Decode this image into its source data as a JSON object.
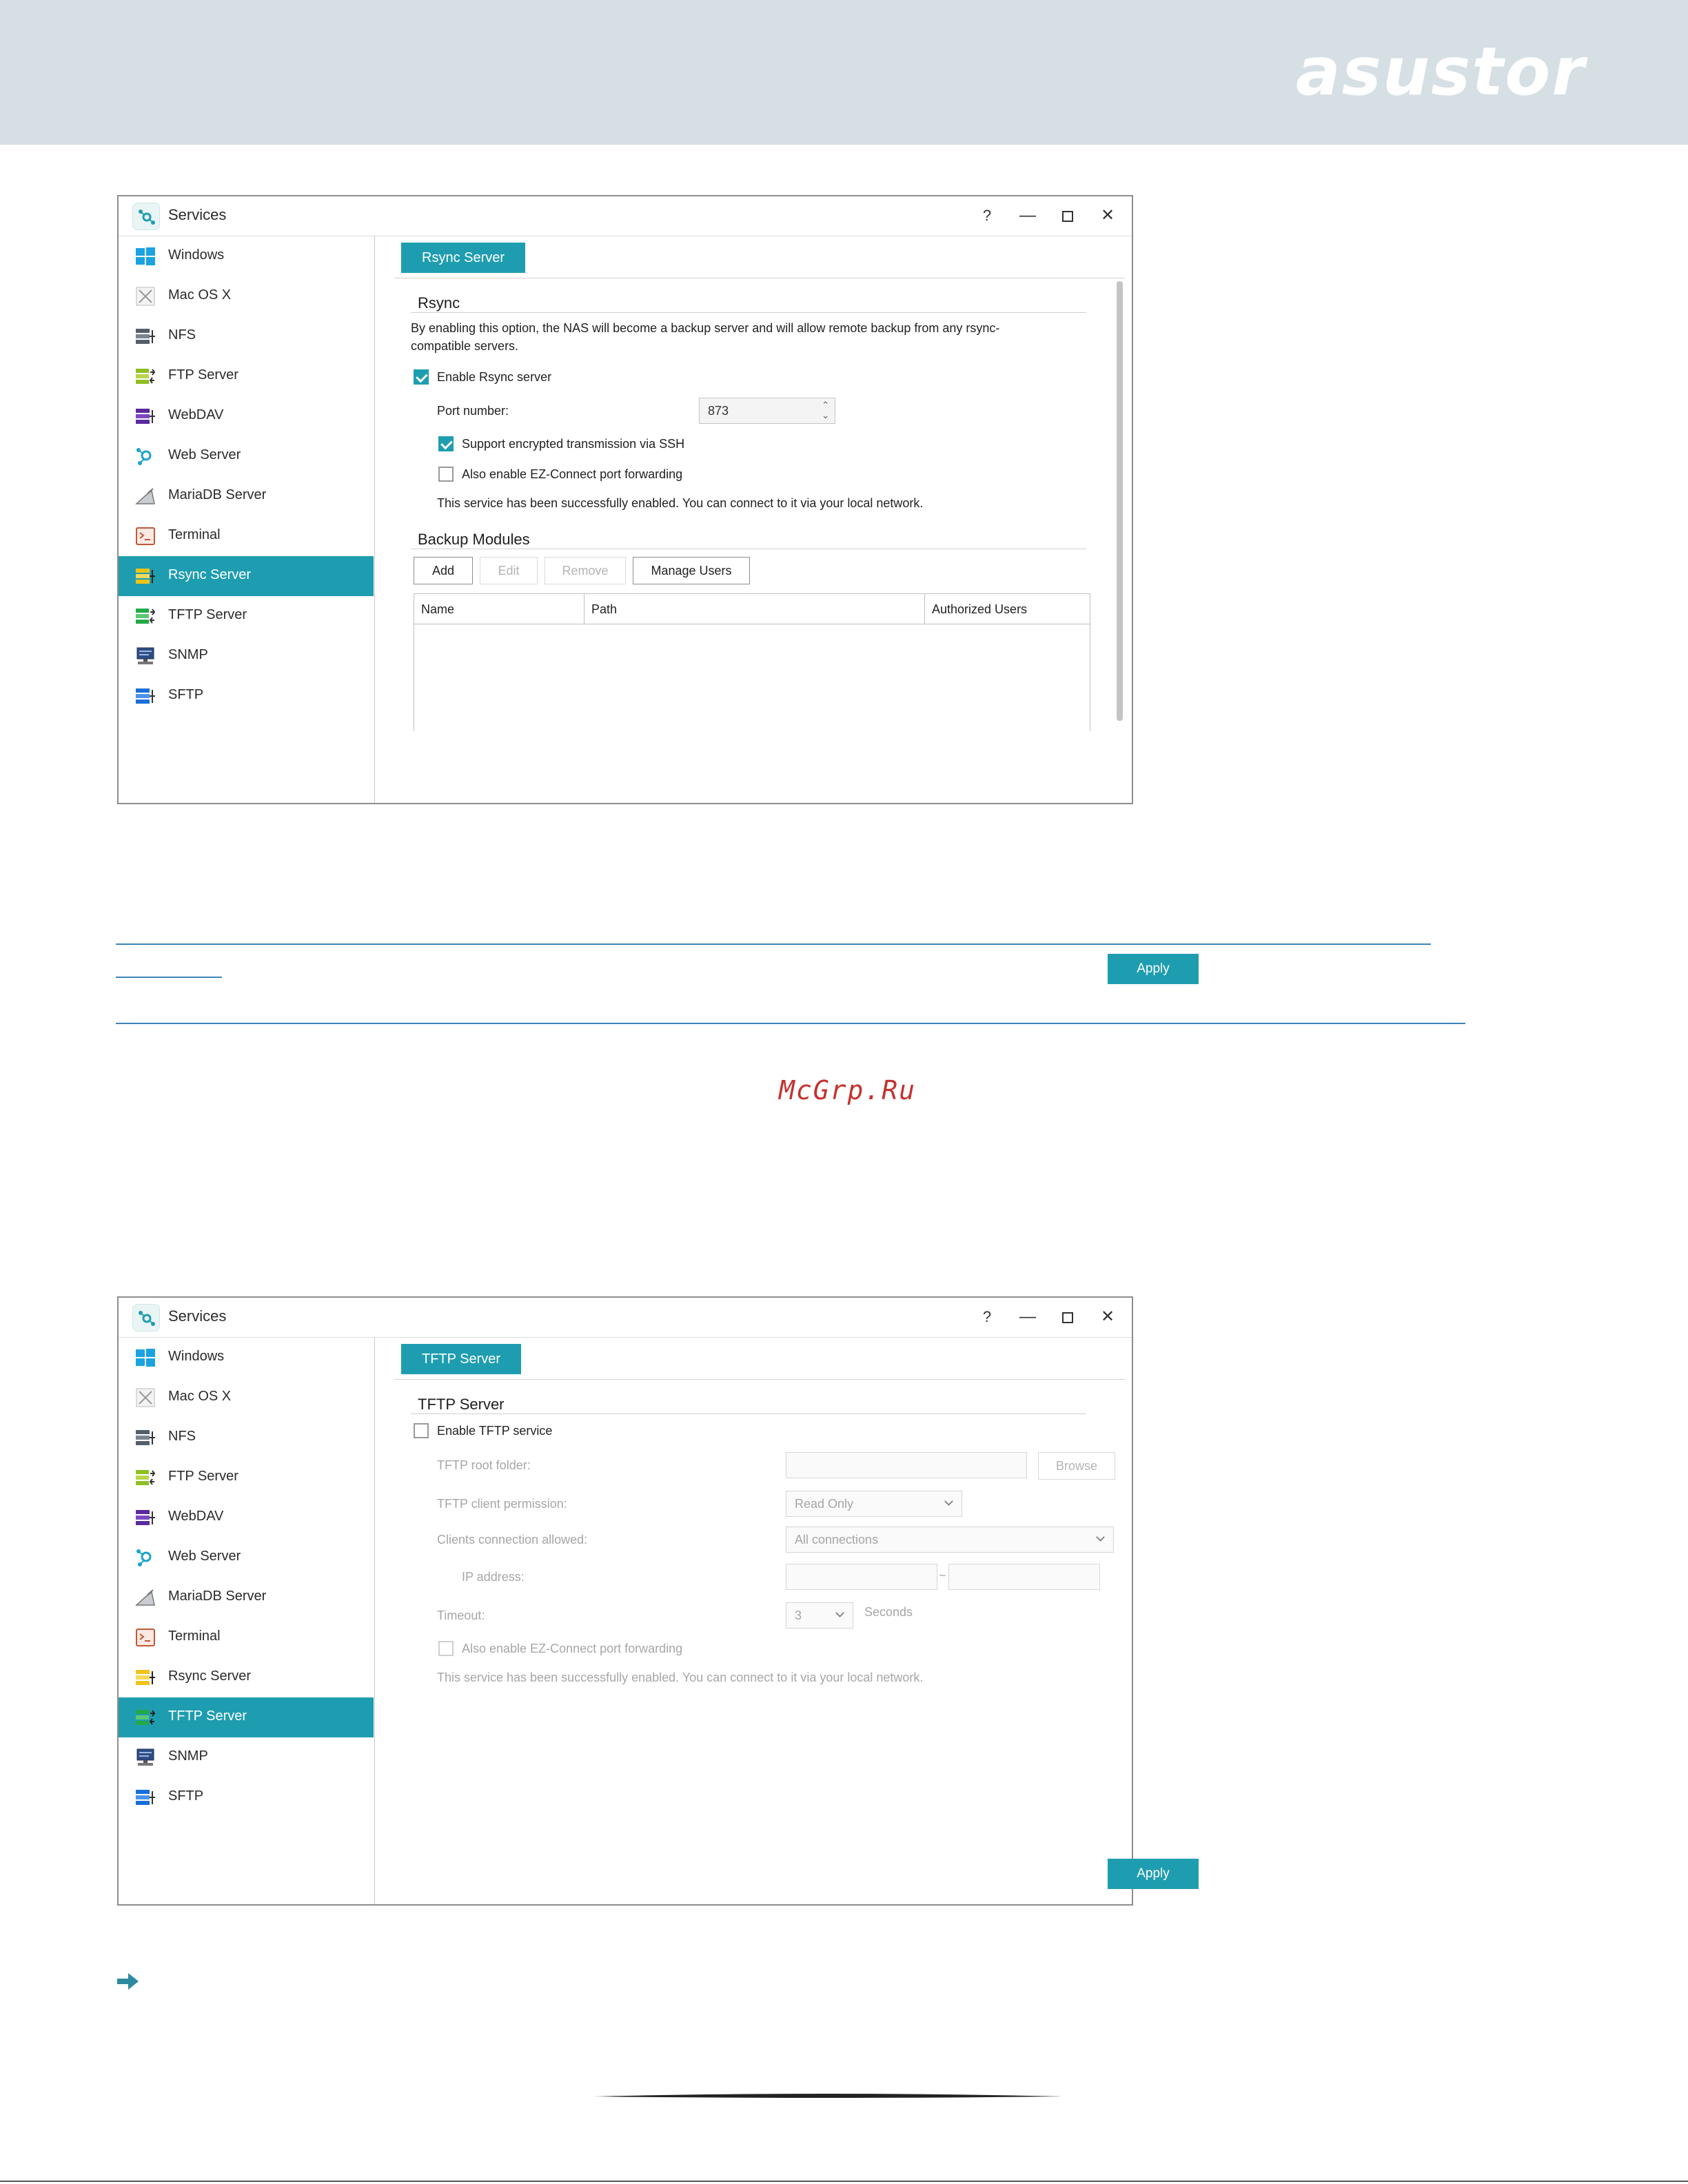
{
  "brand": {
    "logo_text": "asustor",
    "colors": {
      "band": "#d6dfe4",
      "accent": "#1f9db0",
      "rule": "#3d84b8"
    }
  },
  "watermark": "McGrp.Ru",
  "window": {
    "title": "Services",
    "controls": {
      "help": "?",
      "minimize": "—",
      "maximize": "",
      "close": "✕"
    }
  },
  "sidebar_items": [
    {
      "label": "Windows",
      "icon": "windows-icon"
    },
    {
      "label": "Mac OS X",
      "icon": "mac-os-x-icon"
    },
    {
      "label": "NFS",
      "icon": "nfs-icon"
    },
    {
      "label": "FTP Server",
      "icon": "ftp-server-icon"
    },
    {
      "label": "WebDAV",
      "icon": "webdav-icon"
    },
    {
      "label": "Web Server",
      "icon": "web-server-icon"
    },
    {
      "label": "MariaDB Server",
      "icon": "mariadb-icon"
    },
    {
      "label": "Terminal",
      "icon": "terminal-icon"
    },
    {
      "label": "Rsync Server",
      "icon": "rsync-server-icon"
    },
    {
      "label": "TFTP Server",
      "icon": "tftp-server-icon"
    },
    {
      "label": "SNMP",
      "icon": "snmp-icon"
    },
    {
      "label": "SFTP",
      "icon": "sftp-icon"
    }
  ],
  "rsync": {
    "active_item": "Rsync Server",
    "tab": "Rsync Server",
    "section_title": "Rsync",
    "description_line1": "By enabling this option, the NAS will become a backup server and will allow remote backup from any rsync-",
    "description_line2": "compatible servers.",
    "enable_label": "Enable Rsync server",
    "enable_checked": true,
    "port_label": "Port number:",
    "port_value": "873",
    "ssh_label": "Support encrypted transmission via SSH",
    "ssh_checked": true,
    "ezconnect_label": "Also enable EZ-Connect port forwarding",
    "ezconnect_checked": false,
    "status": "This service has been successfully enabled. You can connect to it via your local network.",
    "modules_title": "Backup Modules",
    "buttons": {
      "add": "Add",
      "edit": "Edit",
      "remove": "Remove",
      "manage_users": "Manage Users"
    },
    "columns": [
      "Name",
      "Path",
      "Authorized Users"
    ],
    "apply": "Apply"
  },
  "tftp": {
    "active_item": "TFTP Server",
    "tab": "TFTP Server",
    "section_title": "TFTP Server",
    "enable_label": "Enable TFTP service",
    "enable_checked": false,
    "root_folder_label": "TFTP root folder:",
    "root_folder_value": "",
    "browse": "Browse",
    "permission_label": "TFTP client permission:",
    "permission_value": "Read Only",
    "clients_label": "Clients connection allowed:",
    "clients_value": "All connections",
    "ip_label": "IP address:",
    "ip_separator": "~",
    "timeout_label": "Timeout:",
    "timeout_value": "3",
    "timeout_unit": "Seconds",
    "ezconnect_label": "Also enable EZ-Connect port forwarding",
    "status": "This service has been successfully enabled. You can connect to it via your local network.",
    "apply": "Apply"
  }
}
